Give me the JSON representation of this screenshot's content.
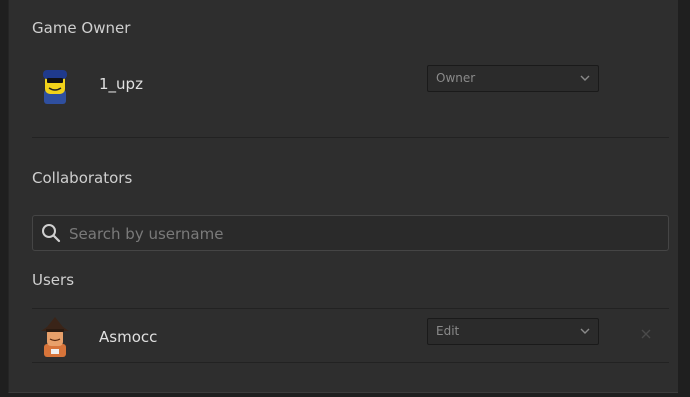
{
  "owner_section": {
    "title": "Game Owner",
    "user": {
      "name": "1_upz",
      "role": "Owner"
    }
  },
  "collaborators_section": {
    "title": "Collaborators",
    "search": {
      "placeholder": "Search by username",
      "value": ""
    }
  },
  "users_section": {
    "title": "Users",
    "users": [
      {
        "name": "Asmocc",
        "permission": "Edit"
      }
    ]
  },
  "colors": {
    "panel": "#2e2e2e",
    "background": "#1f1f1f",
    "text": "#d6d6d6",
    "muted": "#8a8a8a"
  }
}
